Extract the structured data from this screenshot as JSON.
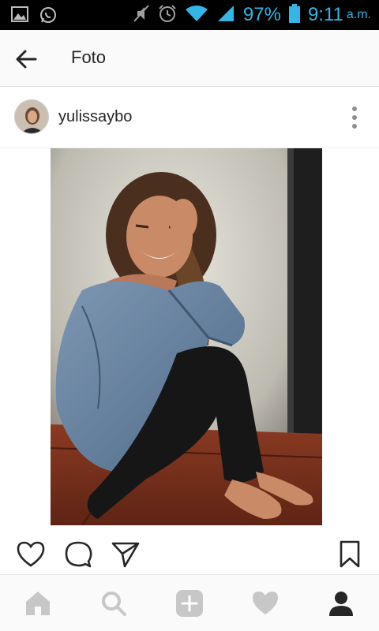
{
  "status_bar": {
    "battery": "97%",
    "time": "9:11",
    "ampm": "a.m.",
    "accent_color": "#33b5e5"
  },
  "app_bar": {
    "title": "Foto"
  },
  "post": {
    "username": "yulissaybo"
  },
  "icons": {
    "status_left": [
      "gallery-icon",
      "whatsapp-icon"
    ],
    "status_right": [
      "mute-icon",
      "alarm-icon",
      "wifi-icon",
      "signal-icon",
      "battery-icon"
    ],
    "actions": [
      "heart-icon",
      "comment-icon",
      "share-icon",
      "bookmark-icon"
    ],
    "nav": [
      "home-icon",
      "search-icon",
      "add-icon",
      "activity-icon",
      "profile-icon"
    ]
  }
}
